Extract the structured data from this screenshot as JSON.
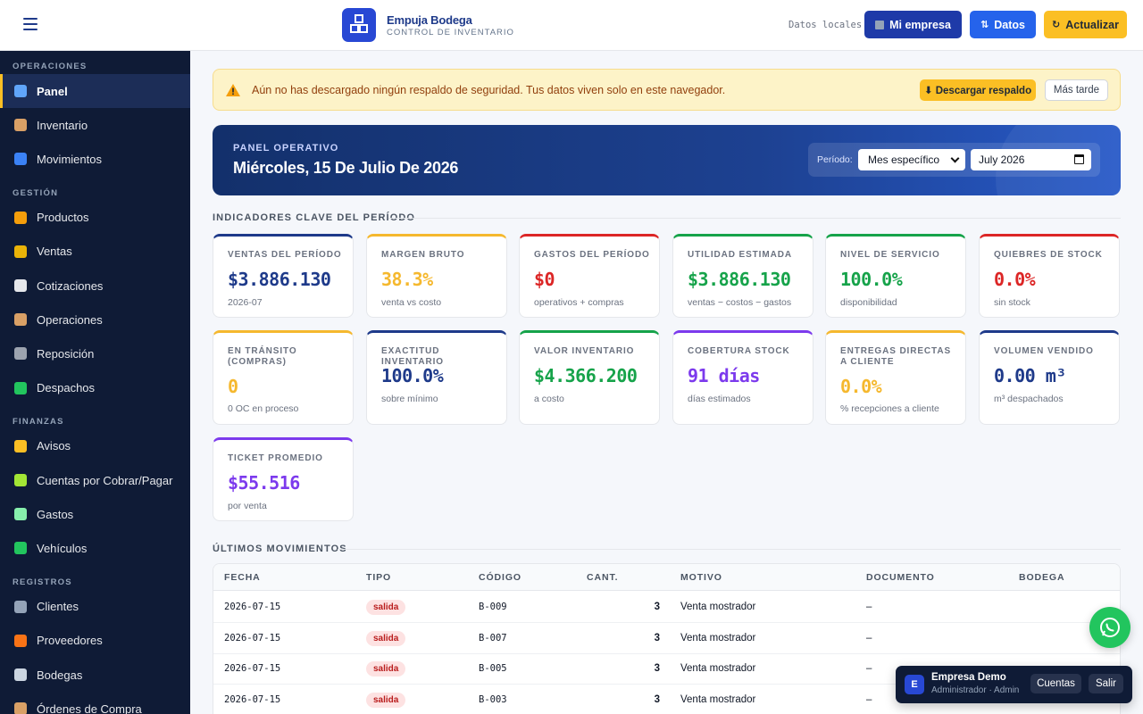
{
  "header": {
    "brand_name": "Empuja Bodega",
    "brand_sub": "CONTROL DE INVENTARIO",
    "local_data": "Datos locales",
    "btn_empresa": "Mi empresa",
    "btn_datos": "Datos",
    "btn_actualizar": "Actualizar"
  },
  "sidebar": {
    "sections": [
      {
        "title": "OPERACIONES",
        "items": [
          {
            "label": "Panel",
            "icon": "chart-icon",
            "color": "#60a5fa",
            "active": true
          },
          {
            "label": "Inventario",
            "icon": "box-icon",
            "color": "#d9a066"
          },
          {
            "label": "Movimientos",
            "icon": "arrows-icon",
            "color": "#3b82f6"
          }
        ]
      },
      {
        "title": "GESTIÓN",
        "items": [
          {
            "label": "Productos",
            "icon": "tag-icon",
            "color": "#f59e0b"
          },
          {
            "label": "Ventas",
            "icon": "money-bag-icon",
            "color": "#eab308"
          },
          {
            "label": "Cotizaciones",
            "icon": "receipt-icon",
            "color": "#e5e7eb"
          },
          {
            "label": "Operaciones",
            "icon": "package-icon",
            "color": "#d9a066"
          },
          {
            "label": "Reposición",
            "icon": "cart-icon",
            "color": "#9ca3af"
          },
          {
            "label": "Despachos",
            "icon": "truck-icon",
            "color": "#22c55e"
          }
        ]
      },
      {
        "title": "FINANZAS",
        "items": [
          {
            "label": "Avisos",
            "icon": "bell-icon",
            "color": "#fbbf24"
          },
          {
            "label": "Cuentas por Cobrar/Pagar",
            "icon": "banknote-icon",
            "color": "#a3e635"
          },
          {
            "label": "Gastos",
            "icon": "money-wings-icon",
            "color": "#86efac"
          },
          {
            "label": "Vehículos",
            "icon": "truck-icon",
            "color": "#22c55e"
          }
        ]
      },
      {
        "title": "REGISTROS",
        "items": [
          {
            "label": "Clientes",
            "icon": "building-icon",
            "color": "#94a3b8"
          },
          {
            "label": "Proveedores",
            "icon": "delivery-truck-icon",
            "color": "#f97316"
          },
          {
            "label": "Bodegas",
            "icon": "warehouse-icon",
            "color": "#cbd5e1"
          },
          {
            "label": "Órdenes de Compra",
            "icon": "clipboard-icon",
            "color": "#d9a066"
          }
        ]
      }
    ]
  },
  "alert": {
    "text": "Aún no has descargado ningún respaldo de seguridad. Tus datos viven solo en este navegador.",
    "download": "⬇ Descargar respaldo",
    "later": "Más tarde"
  },
  "hero": {
    "kicker": "PANEL OPERATIVO",
    "title": "Miércoles, 15 De Julio De 2026",
    "period_label": "Período:",
    "period_mode": "Mes específico",
    "period_month": "July 2026"
  },
  "kpi_title": "INDICADORES CLAVE DEL PERÍODO",
  "kpis": [
    {
      "label": "VENTAS DEL PERÍODO",
      "value": "$3.886.130",
      "sub": "2026-07",
      "color": "#1e3a8a",
      "bar": "#1e3a8a"
    },
    {
      "label": "MARGEN BRUTO",
      "value": "38.3%",
      "sub": "venta vs costo",
      "color": "#f5b82e",
      "bar": "#f5b82e"
    },
    {
      "label": "GASTOS DEL PERÍODO",
      "value": "$0",
      "sub": "operativos + compras",
      "color": "#dc2626",
      "bar": "#dc2626"
    },
    {
      "label": "UTILIDAD ESTIMADA",
      "value": "$3.886.130",
      "sub": "ventas − costos − gastos",
      "color": "#16a34a",
      "bar": "#16a34a"
    },
    {
      "label": "NIVEL DE SERVICIO",
      "value": "100.0%",
      "sub": "disponibilidad",
      "color": "#16a34a",
      "bar": "#16a34a"
    },
    {
      "label": "QUIEBRES DE STOCK",
      "value": "0.0%",
      "sub": "sin stock",
      "color": "#dc2626",
      "bar": "#dc2626"
    },
    {
      "label": "EN TRÁNSITO (COMPRAS)",
      "value": "0",
      "sub": "0 OC en proceso",
      "color": "#f5b82e",
      "bar": "#f5b82e"
    },
    {
      "label": "EXACTITUD INVENTARIO",
      "value": "100.0%",
      "sub": "sobre mínimo",
      "color": "#1e3a8a",
      "bar": "#1e3a8a"
    },
    {
      "label": "VALOR INVENTARIO",
      "value": "$4.366.200",
      "sub": "a costo",
      "color": "#16a34a",
      "bar": "#16a34a"
    },
    {
      "label": "COBERTURA STOCK",
      "value": "91 días",
      "sub": "días estimados",
      "color": "#7c3aed",
      "bar": "#7c3aed"
    },
    {
      "label": "ENTREGAS DIRECTAS A CLIENTE",
      "value": "0.0%",
      "sub": "% recepciones a cliente",
      "color": "#f5b82e",
      "bar": "#f5b82e"
    },
    {
      "label": "VOLUMEN VENDIDO",
      "value": "0.00 m³",
      "sub": "m³ despachados",
      "color": "#1e3a8a",
      "bar": "#1e3a8a"
    },
    {
      "label": "TICKET PROMEDIO",
      "value": "$55.516",
      "sub": "por venta",
      "color": "#7c3aed",
      "bar": "#7c3aed"
    }
  ],
  "movements_title": "ÚLTIMOS MOVIMIENTOS",
  "table": {
    "columns": [
      "FECHA",
      "TIPO",
      "CÓDIGO",
      "CANT.",
      "MOTIVO",
      "DOCUMENTO",
      "BODEGA"
    ],
    "rows": [
      {
        "fecha": "2026-07-15",
        "tipo": "salida",
        "codigo": "B-009",
        "cant": "3",
        "motivo": "Venta mostrador",
        "documento": "–",
        "bodega": ""
      },
      {
        "fecha": "2026-07-15",
        "tipo": "salida",
        "codigo": "B-007",
        "cant": "3",
        "motivo": "Venta mostrador",
        "documento": "–",
        "bodega": ""
      },
      {
        "fecha": "2026-07-15",
        "tipo": "salida",
        "codigo": "B-005",
        "cant": "3",
        "motivo": "Venta mostrador",
        "documento": "–",
        "bodega": ""
      },
      {
        "fecha": "2026-07-15",
        "tipo": "salida",
        "codigo": "B-003",
        "cant": "3",
        "motivo": "Venta mostrador",
        "documento": "–",
        "bodega": ""
      }
    ]
  },
  "company": {
    "avatar": "E",
    "name": "Empresa Demo",
    "role": "Administrador · Admin",
    "btn_cuentas": "Cuentas",
    "btn_salir": "Salir"
  }
}
